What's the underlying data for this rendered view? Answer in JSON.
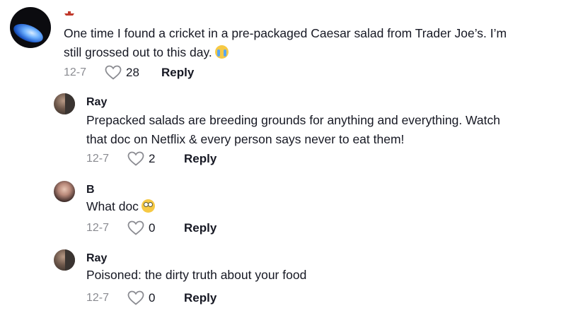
{
  "comments": [
    {
      "username": "",
      "text": "One time I found a cricket in a pre-packaged Caesar salad from Trader Joe’s. I’m",
      "text_line2": "still grossed out to this day.",
      "emoji": "loudly-crying-face",
      "date": "12-7",
      "likes": "28",
      "reply_label": "Reply"
    },
    {
      "username": "Ray",
      "text": "Prepacked salads are breeding grounds for anything and everything. Watch",
      "text_line2": "that doc on Netflix & every person says never to eat them!",
      "date": "12-7",
      "likes": "2",
      "reply_label": "Reply"
    },
    {
      "username": "B",
      "text": "What doc",
      "emoji": "flushed-face",
      "date": "12-7",
      "likes": "0",
      "reply_label": "Reply"
    },
    {
      "username": "Ray",
      "text": "Poisoned: the dirty truth about your food",
      "date": "12-7",
      "likes": "0",
      "reply_label": "Reply"
    }
  ],
  "colors": {
    "text": "#161823",
    "meta": "#8a8b91",
    "background": "#ffffff"
  }
}
